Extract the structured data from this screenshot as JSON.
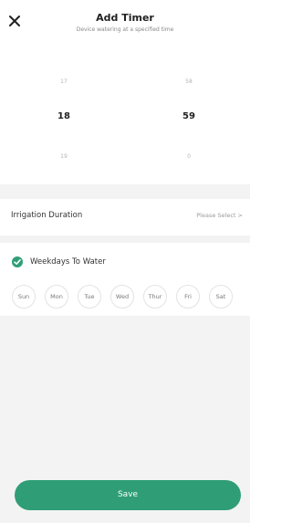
{
  "header": {
    "title": "Add Timer",
    "subtitle": "Device watering at a specified time"
  },
  "picker": {
    "hours": [
      "17",
      "18",
      "19"
    ],
    "minutes": [
      "58",
      "59",
      "0"
    ],
    "selected_hour": "18",
    "selected_minute": "59"
  },
  "irrigation": {
    "label": "Irrigation Duration",
    "value": "Please Select >"
  },
  "weekdays": {
    "label": "Weekdays To Water",
    "days": [
      "Sun",
      "Mon",
      "Tue",
      "Wed",
      "Thur",
      "Fri",
      "Sat"
    ]
  },
  "save_label": "Save",
  "colors": {
    "accent": "#2f9e76",
    "section_bg": "#f3f3f3"
  }
}
